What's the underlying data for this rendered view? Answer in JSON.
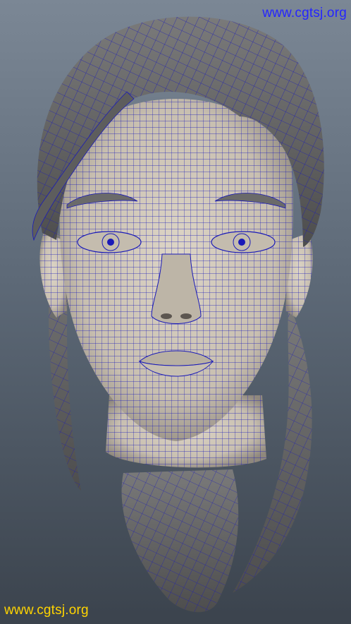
{
  "viewport": {
    "subject": "head-wireframe",
    "colors": {
      "background_top": "#7b8795",
      "background_bottom": "#3b434d",
      "skin": "#cfc6b7",
      "hair": "#6c6c6c",
      "wire": "#1a1ab8",
      "watermark": "#2525ff",
      "watermark_bottom": "#ffd400"
    }
  },
  "watermark": {
    "top": "www.cgtsj.org",
    "bottom": "www.cgtsj.org"
  }
}
